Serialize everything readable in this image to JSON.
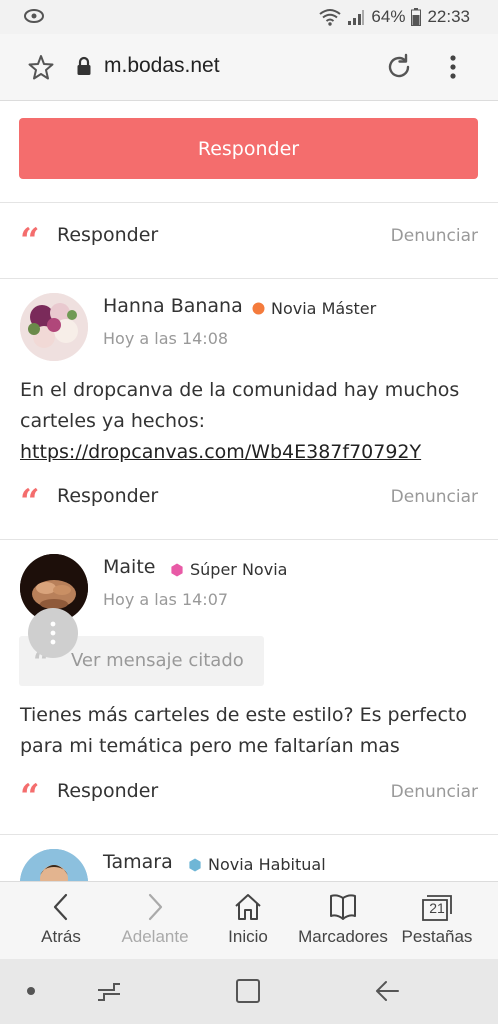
{
  "status_bar": {
    "battery": "64%",
    "time": "22:33"
  },
  "browser": {
    "url": "m.bodas.net"
  },
  "main_reply_button": "Responder",
  "top_actions": {
    "reply": "Responder",
    "report": "Denunciar"
  },
  "posts": [
    {
      "author": "Hanna Banana",
      "badge": "Novia Máster",
      "badge_color": "#f47b3c",
      "time": "Hoy a las 14:08",
      "text": "En el dropcanva de la comunidad hay muchos carteles ya hechos:",
      "link": "https://dropcanvas.com/Wb4E387f70792Y",
      "reply": "Responder",
      "report": "Denunciar"
    },
    {
      "author": "Maite",
      "badge": "Súper Novia",
      "badge_color": "#e85aa6",
      "time": "Hoy a las 14:07",
      "quoted": "Ver mensaje citado",
      "text": "Tienes más carteles de este estilo? Es perfecto para mi temática pero me faltarían mas",
      "reply": "Responder",
      "report": "Denunciar"
    },
    {
      "author": "Tamara",
      "badge": "Novia Habitual",
      "badge_color": "#6fb6d6"
    }
  ],
  "bottom_nav": {
    "back": "Atrás",
    "forward": "Adelante",
    "home": "Inicio",
    "bookmarks": "Marcadores",
    "tabs": "Pestañas",
    "tabs_count": "21"
  },
  "colors": {
    "accent": "#f46d6d"
  }
}
